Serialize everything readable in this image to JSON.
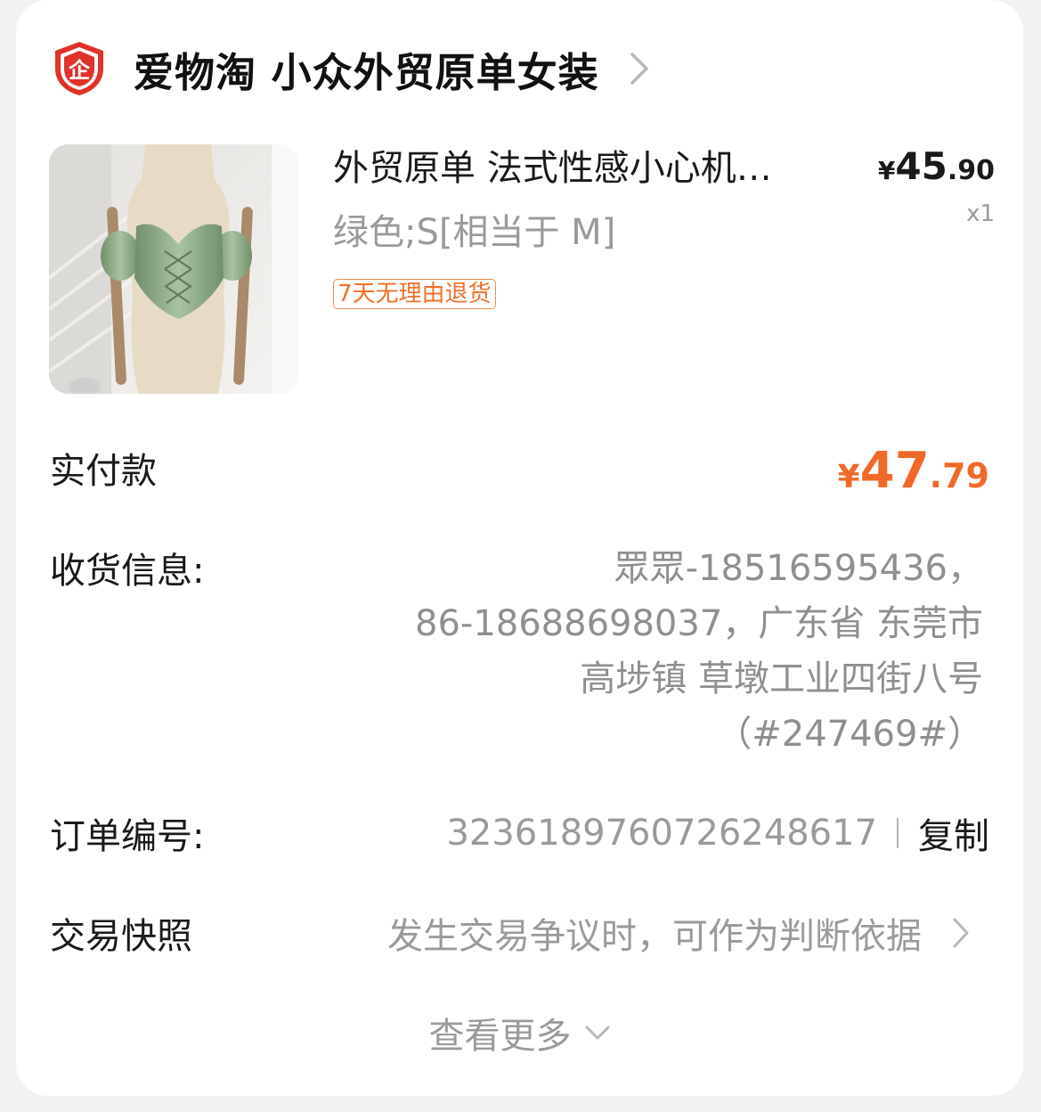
{
  "shop": {
    "badge_icon": "enterprise-shield-icon",
    "badge_char": "企",
    "name": "爱物淘 小众外贸原单女装",
    "chevron_icon": "chevron-right-icon"
  },
  "product": {
    "image_icon": "product-thumbnail-image",
    "title": "外贸原单 法式性感小心机…",
    "variant": "绿色;S[相当于 M]",
    "badge": "7天无理由退货",
    "price_currency": "¥",
    "price_int": "45",
    "price_dec": ".90",
    "quantity": "x1"
  },
  "payment": {
    "label": "实付款",
    "currency": "¥",
    "amount_int": "47",
    "amount_dec": ".79"
  },
  "shipping": {
    "label": "收货信息:",
    "lines": [
      "眾眾-18516595436，",
      "86-18688698037，广东省 东莞市",
      "高埗镇 草墩工业四街八号",
      "（#247469#）"
    ]
  },
  "order": {
    "label": "订单编号:",
    "number": "3236189760726248617",
    "copy_label": "复制"
  },
  "snapshot": {
    "label": "交易快照",
    "description": "发生交易争议时，可作为判断依据"
  },
  "more": {
    "label": "查看更多"
  },
  "colors": {
    "accent": "#f0692a",
    "badge_red": "#e0322a",
    "muted_text": "#9a9a9a",
    "background": "#f2f2f2",
    "card": "#ffffff"
  }
}
